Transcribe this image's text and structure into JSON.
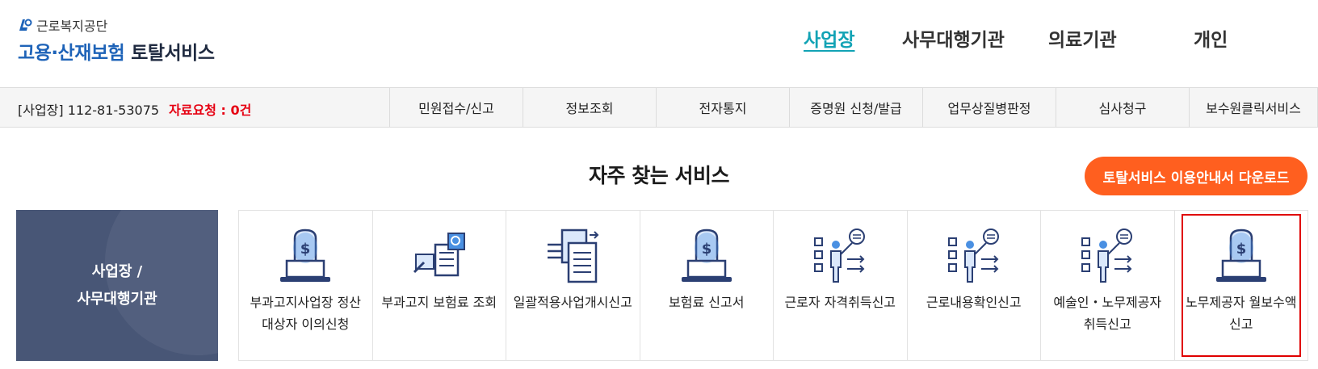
{
  "header": {
    "org_name": "근로복지공단",
    "service_title_blue": "고용·산재보험",
    "service_title_dark": "토탈서비스",
    "nav": [
      {
        "label": "사업장",
        "active": true
      },
      {
        "label": "사무대행기관",
        "active": false
      },
      {
        "label": "의료기관",
        "active": false
      },
      {
        "label": "개인",
        "active": false
      }
    ]
  },
  "subbar": {
    "business_info": "[사업장] 112-81-53075",
    "request_status": "자료요청 : 0건",
    "menu": [
      "민원접수/신고",
      "정보조회",
      "전자통지",
      "증명원 신청/발급",
      "업무상질병판정",
      "심사청구",
      "보수원클릭서비스"
    ]
  },
  "main": {
    "section_title": "자주 찾는 서비스",
    "download_button": "토탈서비스 이용안내서 다운로드",
    "category_label_line1": "사업장 /",
    "category_label_line2": "사무대행기관",
    "services": [
      {
        "label": "부과고지사업장 정산대상자 이의신청",
        "icon": "money-laptop-icon",
        "selected": false
      },
      {
        "label": "부과고지 보험료 조회",
        "icon": "document-search-icon",
        "selected": false
      },
      {
        "label": "일괄적용사업개시신고",
        "icon": "document-transfer-icon",
        "selected": false
      },
      {
        "label": "보험료 신고서",
        "icon": "money-laptop-icon",
        "selected": false
      },
      {
        "label": "근로자 자격취득신고",
        "icon": "presenter-checklist-icon",
        "selected": false
      },
      {
        "label": "근로내용확인신고",
        "icon": "presenter-checklist-icon",
        "selected": false
      },
      {
        "label": "예술인・노무제공자 취득신고",
        "icon": "presenter-checklist-icon",
        "selected": false
      },
      {
        "label": "노무제공자 월보수액 신고",
        "icon": "money-laptop-icon",
        "selected": true
      }
    ]
  },
  "colors": {
    "brand_blue": "#1e63b8",
    "active_nav": "#12a3b5",
    "alert_red": "#e60012",
    "download_orange": "#ff5f1f",
    "category_bg": "#485676",
    "icon_navy": "#2b3f73",
    "icon_blue": "#4a90e2",
    "selection_border": "#e00000"
  }
}
